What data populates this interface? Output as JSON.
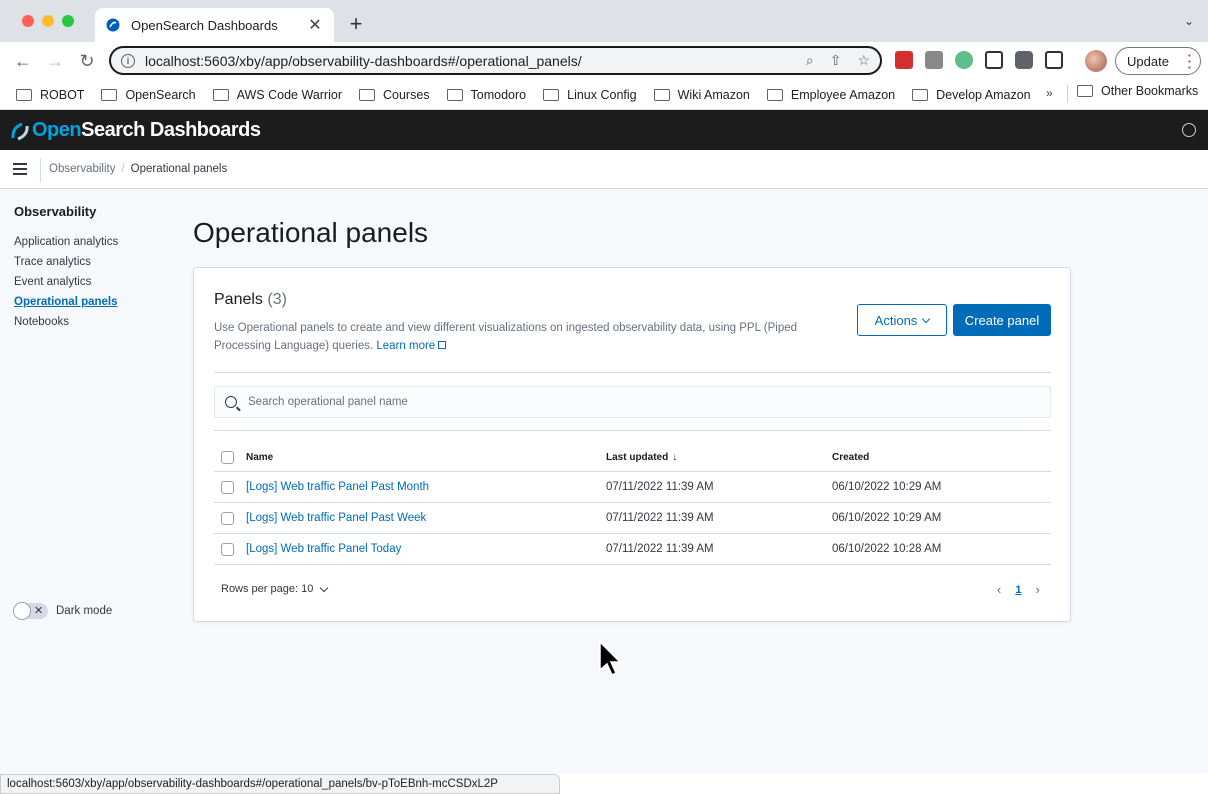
{
  "browser": {
    "tab_title": "OpenSearch Dashboards",
    "url": "localhost:5603/xby/app/observability-dashboards#/operational_panels/",
    "update_label": "Update",
    "bookmarks": [
      "ROBOT",
      "OpenSearch",
      "AWS Code Warrior",
      "Courses",
      "Tomodoro",
      "Linux Config",
      "Wiki Amazon",
      "Employee Amazon",
      "Develop Amazon"
    ],
    "bookmarks_more": "»",
    "other_bookmarks": "Other Bookmarks",
    "status_url": "localhost:5603/xby/app/observability-dashboards#/operational_panels/bv-pToEBnh-mcCSDxL2P"
  },
  "header": {
    "logo_brand": "Open",
    "logo_rest": "Search Dashboards",
    "accent_color": "#00a3e0"
  },
  "breadcrumb": {
    "parent": "Observability",
    "separator": "/",
    "current": "Operational panels"
  },
  "sidenav": {
    "title": "Observability",
    "items": [
      "Application analytics",
      "Trace analytics",
      "Event analytics",
      "Operational panels",
      "Notebooks"
    ],
    "active_index": 3,
    "dark_mode_label": "Dark mode",
    "dark_mode_on": false
  },
  "main": {
    "page_title": "Operational panels",
    "panel_title": "Panels",
    "panel_count": "(3)",
    "description": "Use Operational panels to create and view different visualizations on ingested observability data, using PPL (Piped Processing Language) queries.",
    "learn_more": "Learn more",
    "actions_label": "Actions",
    "create_label": "Create panel",
    "search_placeholder": "Search operational panel name",
    "columns": {
      "name": "Name",
      "last_updated": "Last updated",
      "created": "Created",
      "sort_icon": "↓"
    },
    "rows": [
      {
        "name": "[Logs] Web traffic Panel Past Month",
        "last_updated": "07/11/2022 11:39 AM",
        "created": "06/10/2022 10:29 AM"
      },
      {
        "name": "[Logs] Web traffic Panel Past Week",
        "last_updated": "07/11/2022 11:39 AM",
        "created": "06/10/2022 10:29 AM"
      },
      {
        "name": "[Logs] Web traffic Panel Today",
        "last_updated": "07/11/2022 11:39 AM",
        "created": "06/10/2022 10:28 AM"
      }
    ],
    "rows_per_page": "Rows per page: 10",
    "current_page": "1",
    "primary_color": "#006bb8"
  }
}
